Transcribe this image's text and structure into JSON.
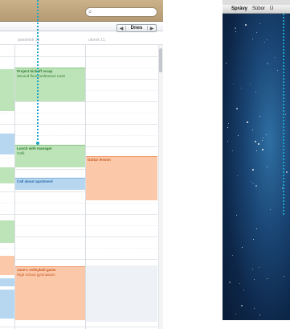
{
  "calendar": {
    "search_icon": "⌕",
    "nav": {
      "prev": "◀",
      "today": "Dnes",
      "next": "▶"
    },
    "day_headers": [
      "pondelok 10.",
      "utorok 11."
    ],
    "events": [
      {
        "title": "Project kickoff recap",
        "subtitle": "Second floor conference room",
        "color": "green"
      },
      {
        "title": "Lunch with manager",
        "subtitle": "Café",
        "color": "green"
      },
      {
        "title": "Call about apartment",
        "subtitle": "",
        "color": "blue"
      },
      {
        "title": "Guitar lesson",
        "subtitle": "",
        "color": "orange"
      },
      {
        "title": "Jane's volleyball game",
        "subtitle": "High school gymnasium",
        "color": "orange"
      }
    ],
    "colors": {
      "green": "#bde3b9",
      "blue": "#b7d7f0",
      "orange": "#fbc8a9",
      "callout": "#1aa3c7"
    }
  },
  "desktop": {
    "menubar": {
      "apple_icon": "",
      "app_name": "Správy",
      "menu_1": "Súbor",
      "menu_2": "Ú"
    }
  }
}
